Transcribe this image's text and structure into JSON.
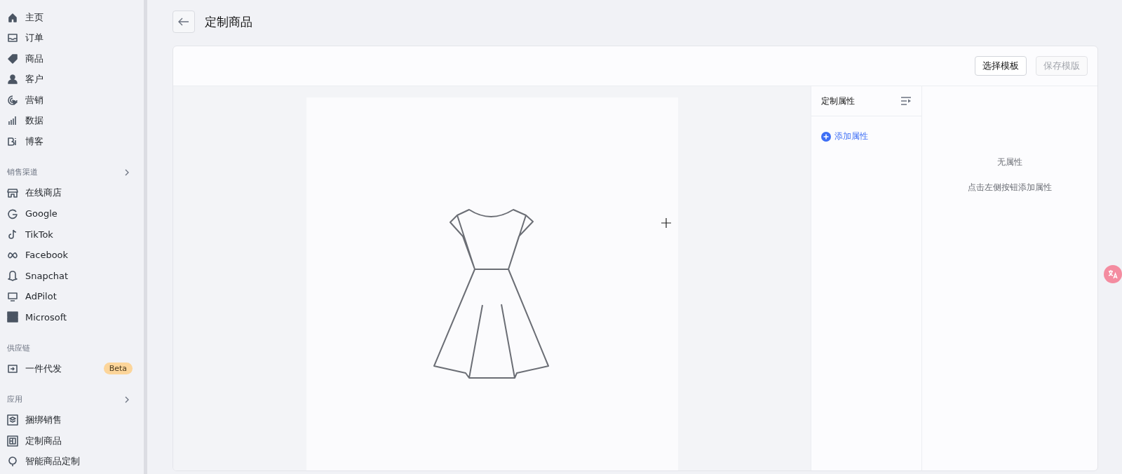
{
  "sidebar": {
    "sections": [
      {
        "items": [
          {
            "label": "主页"
          },
          {
            "label": "订单"
          },
          {
            "label": "商品"
          },
          {
            "label": "客户"
          },
          {
            "label": "营销"
          },
          {
            "label": "数据"
          },
          {
            "label": "博客"
          }
        ]
      },
      {
        "title": "销售渠道",
        "expandable": true,
        "items": [
          {
            "label": "在线商店"
          },
          {
            "label": "Google"
          },
          {
            "label": "TikTok"
          },
          {
            "label": "Facebook"
          },
          {
            "label": "Snapchat"
          },
          {
            "label": "AdPilot"
          },
          {
            "label": "Microsoft"
          }
        ]
      },
      {
        "title": "供应链",
        "expandable": false,
        "items": [
          {
            "label": "一件代发",
            "badge": "Beta"
          }
        ]
      },
      {
        "title": "应用",
        "expandable": true,
        "items": [
          {
            "label": "捆绑销售"
          },
          {
            "label": "定制商品"
          },
          {
            "label": "智能商品定制"
          }
        ]
      }
    ]
  },
  "page": {
    "title": "定制商品"
  },
  "toolbar": {
    "buttons": [
      {
        "label": "选择模板",
        "disabled": false
      },
      {
        "label": "保存模版",
        "disabled": true
      }
    ]
  },
  "attributes_panel": {
    "title": "定制属性",
    "add_link": "添加属性"
  },
  "empty_state": {
    "title": "无属性",
    "hint": "点击左侧按钮添加属性"
  }
}
